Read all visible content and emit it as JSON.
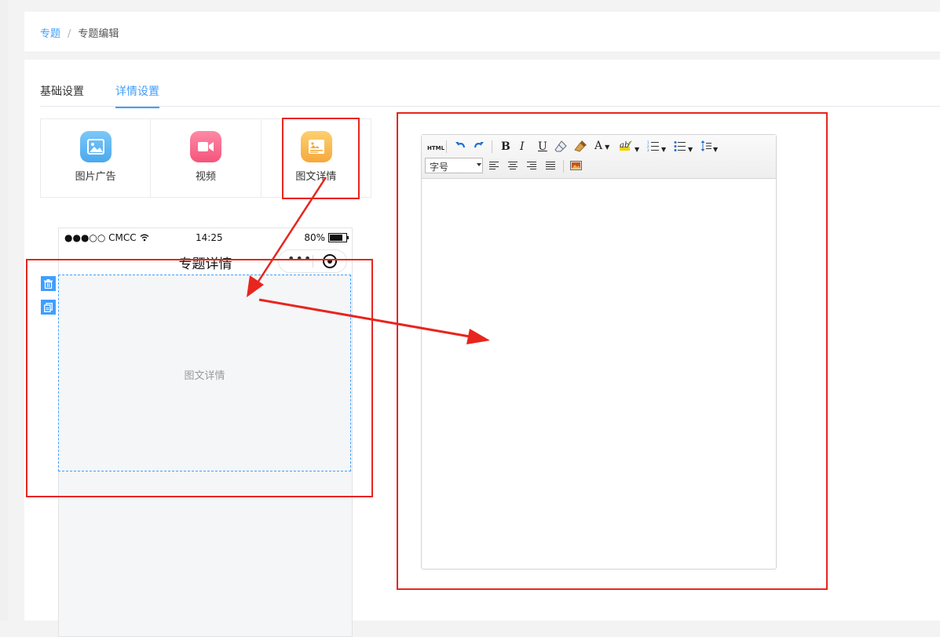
{
  "breadcrumb": {
    "parent": "专题",
    "separator": "/",
    "current": "专题编辑"
  },
  "tabs": [
    {
      "label": "基础设置",
      "active": false
    },
    {
      "label": "详情设置",
      "active": true
    }
  ],
  "palette": [
    {
      "label": "图片广告",
      "icon": "image-icon",
      "color": "#5eb6f3"
    },
    {
      "label": "视频",
      "icon": "video-icon",
      "color": "#f96a8c"
    },
    {
      "label": "图文详情",
      "icon": "image-text-icon",
      "color": "#f9b84a"
    }
  ],
  "phone": {
    "carrier": "●●●○○ CMCC",
    "time": "14:25",
    "battery": "80%",
    "nav_title": "专题详情",
    "more": "•••"
  },
  "canvas": {
    "block_label": "图文详情"
  },
  "editor": {
    "html_btn": "HTML",
    "bold": "B",
    "italic": "I",
    "underline": "U",
    "font_color": "A",
    "font_size_select": "字号",
    "content": ""
  },
  "colors": {
    "accent": "#409eff",
    "annotation": "#e8251e"
  }
}
